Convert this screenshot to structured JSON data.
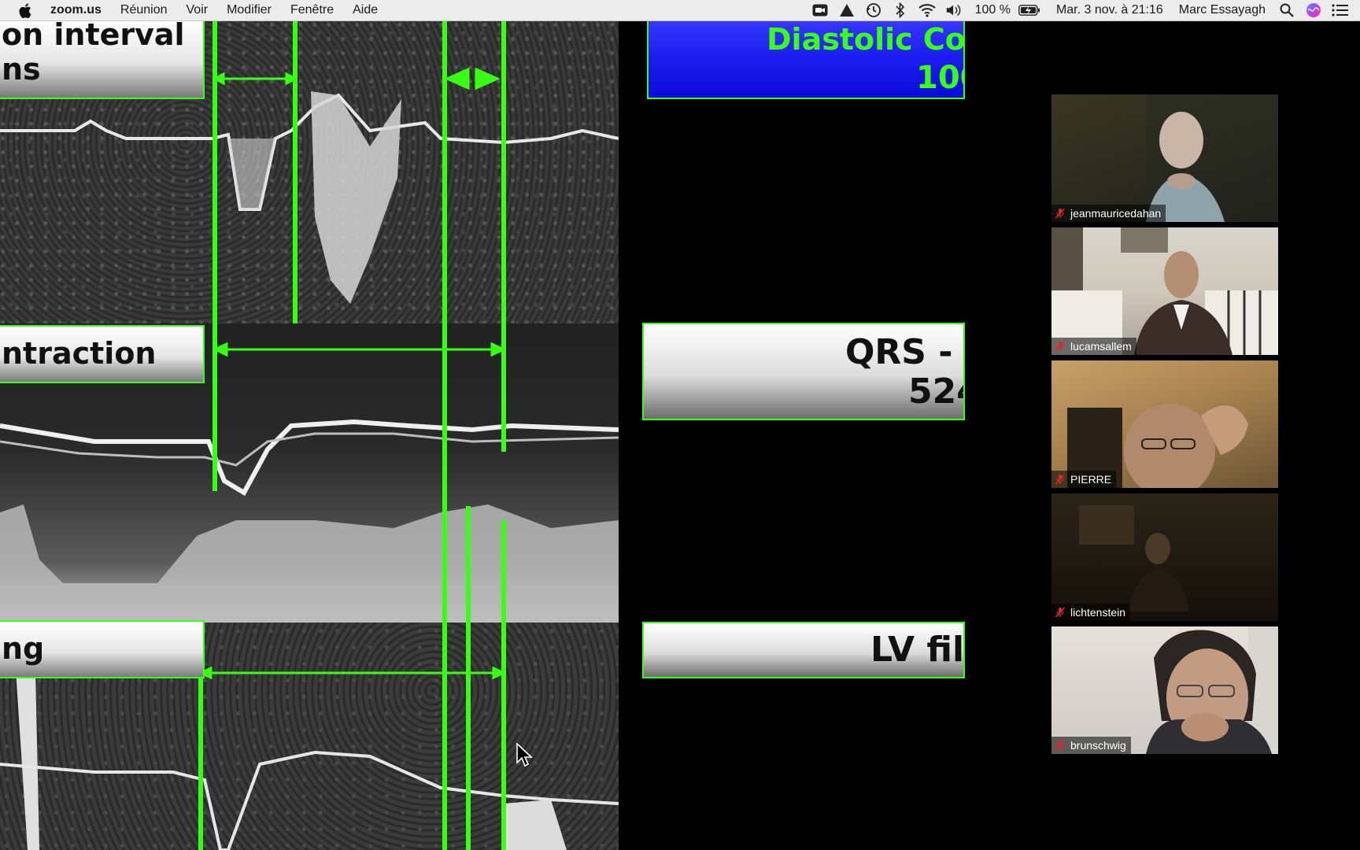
{
  "menubar": {
    "app_name": "zoom.us",
    "menus": [
      "Réunion",
      "Voir",
      "Modifier",
      "Fenêtre",
      "Aide"
    ],
    "battery": "100 %",
    "datetime": "Mar. 3 nov. à  21:16",
    "user": "Marc Essayagh"
  },
  "presentation": {
    "top_label_line1": "on interval",
    "top_label_line2": "ns",
    "mid_label": "ntraction",
    "bot_label": "ng",
    "blue_box_line1": "Diastolic Co",
    "blue_box_line2": "100",
    "qrs_line1": "QRS -",
    "qrs_line2": "524",
    "lv_label": "LV fil"
  },
  "participants": [
    {
      "name": "jeanmauricedahan",
      "muted": true
    },
    {
      "name": "lucamsallem",
      "muted": true
    },
    {
      "name": "PIERRE",
      "muted": true
    },
    {
      "name": "lichtenstein",
      "muted": true
    },
    {
      "name": "brunschwig",
      "muted": true
    }
  ],
  "colors": {
    "accent_green": "#39ff14",
    "blue_box": "#1d1df0",
    "menubar_bg": "#ececec",
    "muted_mic": "#e0262b"
  }
}
